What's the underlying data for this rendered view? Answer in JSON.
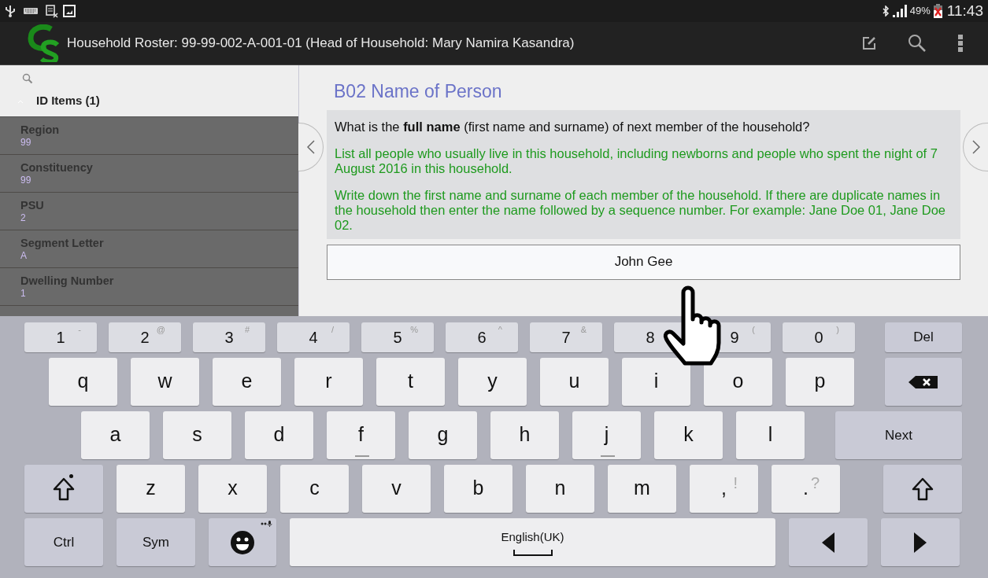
{
  "status_bar": {
    "battery": "49%",
    "time": "11:43"
  },
  "app_bar": {
    "title": "Household Roster: 99-99-002-A-001-01 (Head of Household: Mary Namira Kasandra)"
  },
  "sidebar": {
    "group": {
      "label": "ID Items (1)",
      "expanded": true
    },
    "items": [
      {
        "label": "Region",
        "value": "99"
      },
      {
        "label": "Constituency",
        "value": "99"
      },
      {
        "label": "PSU",
        "value": "2"
      },
      {
        "label": "Segment Letter",
        "value": "A"
      },
      {
        "label": "Dwelling Number",
        "value": "1"
      }
    ]
  },
  "question": {
    "title": "B02 Name of Person",
    "prompt": "What is the **full name** (first name and surname) of next member of the household?",
    "instructions": [
      "List all people who usually live in this household, including newborns and people who spent the night of 7 August 2016  in this household.",
      "Write down the first name and surname of each member of the household. If there are duplicate names in the household then enter the name followed by a sequence number. For example: Jane Doe 01, Jane Doe 02."
    ],
    "answer": {
      "value": "John Gee"
    }
  },
  "keyboard": {
    "rows": [
      [
        {
          "kind": "char",
          "label": "1",
          "alt": "-"
        },
        {
          "kind": "char",
          "label": "2",
          "alt": "@"
        },
        {
          "kind": "char",
          "label": "3",
          "alt": "#"
        },
        {
          "kind": "char",
          "label": "4",
          "alt": "/"
        },
        {
          "kind": "char",
          "label": "5",
          "alt": "%"
        },
        {
          "kind": "char",
          "label": "6",
          "alt": "^"
        },
        {
          "kind": "char",
          "label": "7",
          "alt": "&"
        },
        {
          "kind": "char",
          "label": "8"
        },
        {
          "kind": "char",
          "label": "9",
          "alt": "("
        },
        {
          "kind": "char",
          "label": "0",
          "alt": ")"
        },
        {
          "kind": "text",
          "label": "Del"
        }
      ],
      [
        {
          "kind": "letter",
          "label": "q"
        },
        {
          "kind": "letter",
          "label": "w"
        },
        {
          "kind": "letter",
          "label": "e"
        },
        {
          "kind": "letter",
          "label": "r"
        },
        {
          "kind": "letter",
          "label": "t"
        },
        {
          "kind": "letter",
          "label": "y"
        },
        {
          "kind": "letter",
          "label": "u"
        },
        {
          "kind": "letter",
          "label": "i"
        },
        {
          "kind": "letter",
          "label": "o"
        },
        {
          "kind": "letter",
          "label": "p"
        },
        {
          "kind": "backspace"
        }
      ],
      [
        {
          "kind": "letter",
          "label": "a"
        },
        {
          "kind": "letter",
          "label": "s"
        },
        {
          "kind": "letter",
          "label": "d"
        },
        {
          "kind": "letter",
          "label": "f",
          "marked": true
        },
        {
          "kind": "letter",
          "label": "g"
        },
        {
          "kind": "letter",
          "label": "h"
        },
        {
          "kind": "letter",
          "label": "j",
          "marked": true
        },
        {
          "kind": "letter",
          "label": "k"
        },
        {
          "kind": "letter",
          "label": "l"
        },
        {
          "kind": "text",
          "label": "Next"
        }
      ],
      [
        {
          "kind": "shift",
          "on": true
        },
        {
          "kind": "letter",
          "label": "z"
        },
        {
          "kind": "letter",
          "label": "x"
        },
        {
          "kind": "letter",
          "label": "c"
        },
        {
          "kind": "letter",
          "label": "v"
        },
        {
          "kind": "letter",
          "label": "b"
        },
        {
          "kind": "letter",
          "label": "n"
        },
        {
          "kind": "letter",
          "label": "m"
        },
        {
          "kind": "letter",
          "label": ",",
          "alt": "!"
        },
        {
          "kind": "letter",
          "label": ".",
          "alt": "?"
        },
        {
          "kind": "shift",
          "on": false
        }
      ],
      [
        {
          "kind": "text",
          "label": "Ctrl"
        },
        {
          "kind": "text",
          "label": "Sym"
        },
        {
          "kind": "emoji"
        },
        {
          "kind": "space",
          "label": "English(UK)"
        },
        {
          "kind": "left"
        },
        {
          "kind": "right"
        }
      ]
    ]
  }
}
